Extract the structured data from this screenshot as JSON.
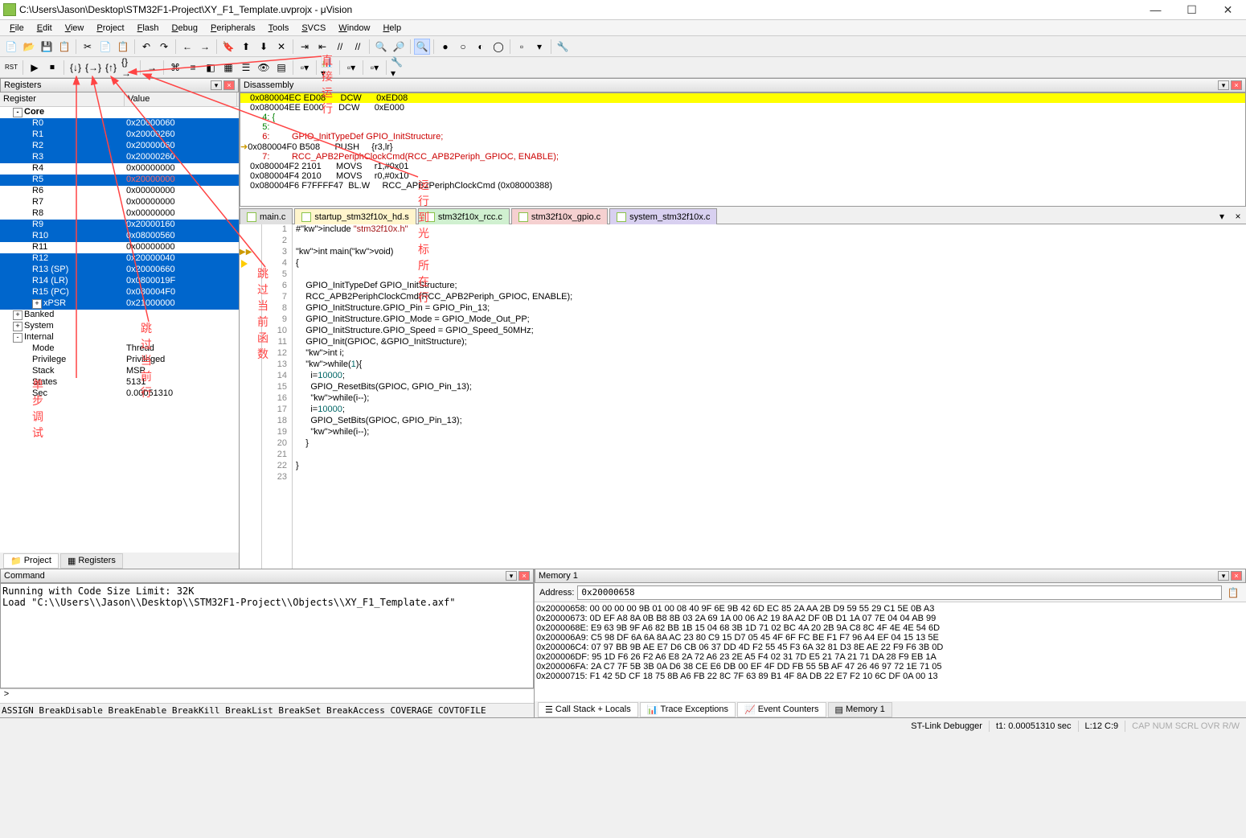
{
  "window": {
    "title": "C:\\Users\\Jason\\Desktop\\STM32F1-Project\\XY_F1_Template.uvprojx - μVision"
  },
  "menu": [
    "File",
    "Edit",
    "View",
    "Project",
    "Flash",
    "Debug",
    "Peripherals",
    "Tools",
    "SVCS",
    "Window",
    "Help"
  ],
  "panels": {
    "registers": "Registers",
    "disassembly": "Disassembly",
    "command": "Command",
    "memory": "Memory 1"
  },
  "reg_header": {
    "c1": "Register",
    "c2": "Value"
  },
  "registers": [
    {
      "lvl": 0,
      "name": "Core",
      "val": "",
      "hdr": true,
      "tree": "-"
    },
    {
      "lvl": 1,
      "name": "R0",
      "val": "0x20000060",
      "sel": true
    },
    {
      "lvl": 1,
      "name": "R1",
      "val": "0x20000260",
      "sel": true
    },
    {
      "lvl": 1,
      "name": "R2",
      "val": "0x20000060",
      "sel": true
    },
    {
      "lvl": 1,
      "name": "R3",
      "val": "0x20000260",
      "sel": true
    },
    {
      "lvl": 1,
      "name": "R4",
      "val": "0x00000000"
    },
    {
      "lvl": 1,
      "name": "R5",
      "val": "0x20000000",
      "selred": true
    },
    {
      "lvl": 1,
      "name": "R6",
      "val": "0x00000000"
    },
    {
      "lvl": 1,
      "name": "R7",
      "val": "0x00000000"
    },
    {
      "lvl": 1,
      "name": "R8",
      "val": "0x00000000"
    },
    {
      "lvl": 1,
      "name": "R9",
      "val": "0x20000160",
      "sel": true
    },
    {
      "lvl": 1,
      "name": "R10",
      "val": "0x08000560",
      "sel": true
    },
    {
      "lvl": 1,
      "name": "R11",
      "val": "0x00000000"
    },
    {
      "lvl": 1,
      "name": "R12",
      "val": "0x20000040",
      "sel": true
    },
    {
      "lvl": 1,
      "name": "R13 (SP)",
      "val": "0x20000660",
      "sel": true
    },
    {
      "lvl": 1,
      "name": "R14 (LR)",
      "val": "0x0800019F",
      "sel": true
    },
    {
      "lvl": 1,
      "name": "R15 (PC)",
      "val": "0x080004F0",
      "sel": true
    },
    {
      "lvl": 1,
      "name": "xPSR",
      "val": "0x21000000",
      "sel": true,
      "tree": "+"
    },
    {
      "lvl": 0,
      "name": "Banked",
      "val": "",
      "tree": "+"
    },
    {
      "lvl": 0,
      "name": "System",
      "val": "",
      "tree": "+"
    },
    {
      "lvl": 0,
      "name": "Internal",
      "val": "",
      "tree": "-"
    },
    {
      "lvl": 1,
      "name": "Mode",
      "val": "Thread"
    },
    {
      "lvl": 1,
      "name": "Privilege",
      "val": "Privileged"
    },
    {
      "lvl": 1,
      "name": "Stack",
      "val": "MSP"
    },
    {
      "lvl": 1,
      "name": "States",
      "val": "5131"
    },
    {
      "lvl": 1,
      "name": "Sec",
      "val": "0.00051310"
    }
  ],
  "bottom_left_tabs": [
    "Project",
    "Registers"
  ],
  "disasm": [
    {
      "t": "0x080004EC ED08      DCW      0xED08",
      "hl": true
    },
    {
      "t": "0x080004EE E000      DCW      0xE000"
    },
    {
      "t": "     4: {",
      "src": true
    },
    {
      "t": "     5:  ",
      "src": true
    },
    {
      "t": "     6:         GPIO_InitTypeDef GPIO_InitStructure;",
      "src": true
    },
    {
      "t": "0x080004F0 B508      PUSH     {r3,lr}",
      "pc": true
    },
    {
      "t": "     7:         RCC_APB2PeriphClockCmd(RCC_APB2Periph_GPIOC, ENABLE);",
      "src": true
    },
    {
      "t": "0x080004F2 2101      MOVS     r1,#0x01"
    },
    {
      "t": "0x080004F4 2010      MOVS     r0,#0x10"
    },
    {
      "t": "0x080004F6 F7FFFF47  BL.W     RCC_APB2PeriphClockCmd (0x08000388)"
    }
  ],
  "file_tabs": [
    {
      "name": "main.c",
      "cls": "t0"
    },
    {
      "name": "startup_stm32f10x_hd.s",
      "cls": "t1"
    },
    {
      "name": "stm32f10x_rcc.c",
      "cls": "t2"
    },
    {
      "name": "stm32f10x_gpio.c",
      "cls": "t3"
    },
    {
      "name": "system_stm32f10x.c",
      "cls": "t4"
    }
  ],
  "code": [
    "#include \"stm32f10x.h\"",
    "",
    "int main(void)",
    "{",
    "",
    "    GPIO_InitTypeDef GPIO_InitStructure;",
    "    RCC_APB2PeriphClockCmd(RCC_APB2Periph_GPIOC, ENABLE);",
    "    GPIO_InitStructure.GPIO_Pin = GPIO_Pin_13;",
    "    GPIO_InitStructure.GPIO_Mode = GPIO_Mode_Out_PP;",
    "    GPIO_InitStructure.GPIO_Speed = GPIO_Speed_50MHz;",
    "    GPIO_Init(GPIOC, &GPIO_InitStructure);",
    "    int i;",
    "    while(1){",
    "      i=10000;",
    "      GPIO_ResetBits(GPIOC, GPIO_Pin_13);",
    "      while(i--);",
    "      i=10000;",
    "      GPIO_SetBits(GPIOC, GPIO_Pin_13);",
    "      while(i--);",
    "    }",
    "    ",
    "}",
    ""
  ],
  "command_output": "Running with Code Size Limit: 32K\nLoad \"C:\\\\Users\\\\Jason\\\\Desktop\\\\STM32F1-Project\\\\Objects\\\\XY_F1_Template.axf\"\n",
  "command_hints": "ASSIGN BreakDisable BreakEnable BreakKill BreakList BreakSet BreakAccess COVERAGE COVTOFILE",
  "command_prompt": ">",
  "memory": {
    "addr_label": "Address:",
    "addr_value": "0x20000658",
    "lines": [
      "0x20000658: 00 00 00 00 9B 01 00 08 40 9F 6E 9B 42 6D EC 85 2A AA 2B D9 59 55 29 C1 5E 0B A3",
      "0x20000673: 0D EF A8 8A 0B B8 8B 03 2A 69 1A 00 06 A2 19 8A A2 DF 0B D1 1A 07 7E 04 04 AB 99",
      "0x2000068E: E9 63 9B 9F A6 82 BB 1B 15 04 68 3B 1D 71 02 BC 4A 20 2B 9A C8 8C 4F 4E 4E 54 6D",
      "0x200006A9: C5 98 DF 6A 6A 8A AC 23 80 C9 15 D7 05 45 4F 6F FC BE F1 F7 96 A4 EF 04 15 13 5E",
      "0x200006C4: 07 97 BB 9B AE E7 D6 CB 06 37 DD 4D F2 55 45 F3 6A 32 81 D3 8E AE 22 F9 F6 3B 0D",
      "0x200006DF: 95 1D F6 26 F2 A6 E8 2A 72 A6 23 2E A5 F4 02 31 7D E5 21 7A 21 71 DA 28 F9 EB 1A",
      "0x200006FA: 2A C7 7F 5B 3B 0A D6 38 CE E6 DB 00 EF 4F DD FB 55 5B AF 47 26 46 97 72 1E 71 05",
      "0x20000715: F1 42 5D CF 18 75 8B A6 FB 22 8C 7F 63 89 B1 4F 8A DB 22 E7 F2 10 6C DF 0A 00 13"
    ]
  },
  "bottom_right_tabs": [
    "Call Stack + Locals",
    "Trace Exceptions",
    "Event Counters",
    "Memory 1"
  ],
  "status": {
    "debugger": "ST-Link Debugger",
    "time": "t1: 0.00051310 sec",
    "cursor": "L:12 C:9",
    "indicators": "CAP  NUM  SCRL  OVR  R/W"
  },
  "annotations": {
    "a1": "直接运行",
    "a2": "运行到光标所在行",
    "a3": "跳过当前函数",
    "a4": "跳过当前行",
    "a5": "单步调试"
  }
}
